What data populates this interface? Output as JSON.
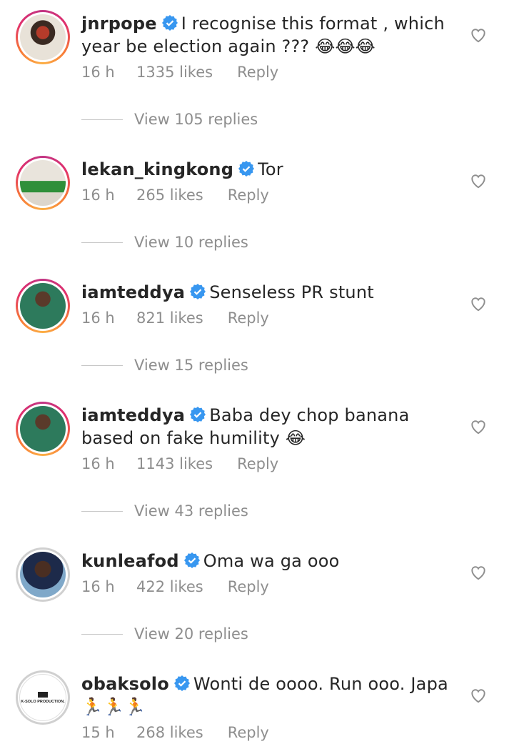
{
  "comments": [
    {
      "username": "jnrpope",
      "text": "I recognise this format , which year be election again ??? 😂😂😂",
      "time": "16 h",
      "likes": "1335 likes",
      "reply": "Reply",
      "view_replies": "View 105 replies",
      "avatar_icon": "user-avatar-icon"
    },
    {
      "username": "lekan_kingkong",
      "text": "Tor",
      "time": "16 h",
      "likes": "265 likes",
      "reply": "Reply",
      "view_replies": "View 10 replies",
      "avatar_icon": "user-avatar-icon"
    },
    {
      "username": "iamteddya",
      "text": "Senseless PR stunt",
      "time": "16 h",
      "likes": "821 likes",
      "reply": "Reply",
      "view_replies": "View 15 replies",
      "avatar_icon": "user-avatar-icon"
    },
    {
      "username": "iamteddya",
      "text": "Baba dey chop banana based on fake humility 😂",
      "time": "16 h",
      "likes": "1143 likes",
      "reply": "Reply",
      "view_replies": "View 43 replies",
      "avatar_icon": "user-avatar-icon"
    },
    {
      "username": "kunleafod",
      "text": "Oma wa ga ooo",
      "time": "16 h",
      "likes": "422 likes",
      "reply": "Reply",
      "view_replies": "View 20 replies",
      "avatar_icon": "user-avatar-icon"
    },
    {
      "username": "obaksolo",
      "text": "Wonti de oooo. Run ooo. Japa 🏃🏃🏃",
      "time": "15 h",
      "likes": "268 likes",
      "reply": "Reply",
      "avatar_label": "K-SOLO PRODUCTION.",
      "avatar_icon": "brand-logo-icon"
    }
  ],
  "colors": {
    "verified": "#3897f0",
    "secondary_text": "#8e8e8e",
    "primary_text": "#262626"
  }
}
